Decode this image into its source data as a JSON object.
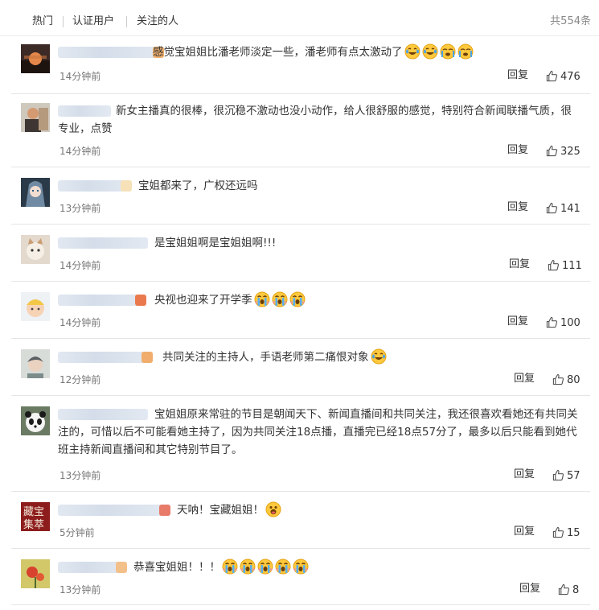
{
  "tabs": [
    {
      "label": "热门"
    },
    {
      "label": "认证用户"
    },
    {
      "label": "关注的人"
    }
  ],
  "total": "共554条",
  "comments": [
    {
      "text": "感觉宝姐姐比潘老师淡定一些，潘老师有点太激动了",
      "emojis": [
        "laugh-cry",
        "laugh-cry",
        "crying",
        "crying"
      ],
      "time": "14分钟前",
      "reply": "回复",
      "likes": "476",
      "avatar_icon": "sunset-avatar-icon"
    },
    {
      "text": "新女主播真的很棒，很沉稳不激动也没小动作，给人很舒服的感觉，特别符合新闻联播气质，很专业，点赞",
      "emojis": [],
      "time": "14分钟前",
      "reply": "回复",
      "likes": "325",
      "avatar_icon": "person-avatar-icon"
    },
    {
      "text": "宝姐都来了，广权还远吗",
      "emojis": [],
      "time": "13分钟前",
      "reply": "回复",
      "likes": "141",
      "avatar_icon": "anime-girl-avatar-icon"
    },
    {
      "text": "是宝姐姐啊是宝姐姐啊!!!",
      "emojis": [],
      "time": "14分钟前",
      "reply": "回复",
      "likes": "111",
      "avatar_icon": "cat-avatar-icon"
    },
    {
      "text": "央视也迎来了开学季",
      "emojis": [
        "tears",
        "tears",
        "tears"
      ],
      "time": "14分钟前",
      "reply": "回复",
      "likes": "100",
      "avatar_icon": "baby-avatar-icon"
    },
    {
      "text": "共同关注的主持人，手语老师第二痛恨对象",
      "emojis": [
        "laugh-cry"
      ],
      "time": "12分钟前",
      "reply": "回复",
      "likes": "80",
      "avatar_icon": "boy-avatar-icon"
    },
    {
      "text": "宝姐姐原来常驻的节目是朝闻天下、新闻直播间和共同关注，我还很喜欢看她还有共同关注的，可惜以后不可能看她主持了，因为共同关注18点播，直播完已经18点57分了，最多以后只能看到她代班主持新闻直播间和其它特别节目了。",
      "emojis": [],
      "time": "13分钟前",
      "reply": "回复",
      "likes": "57",
      "avatar_icon": "panda-avatar-icon"
    },
    {
      "text": "天呐！宝藏姐姐！",
      "emojis": [
        "shocked"
      ],
      "time": "5分钟前",
      "reply": "回复",
      "likes": "15",
      "avatar_icon": "calligraphy-avatar-icon"
    },
    {
      "text": "恭喜宝姐姐！！！",
      "emojis": [
        "tears",
        "tears",
        "tears",
        "tears",
        "tears"
      ],
      "time": "13分钟前",
      "reply": "回复",
      "likes": "8",
      "avatar_icon": "flower-avatar-icon"
    }
  ]
}
